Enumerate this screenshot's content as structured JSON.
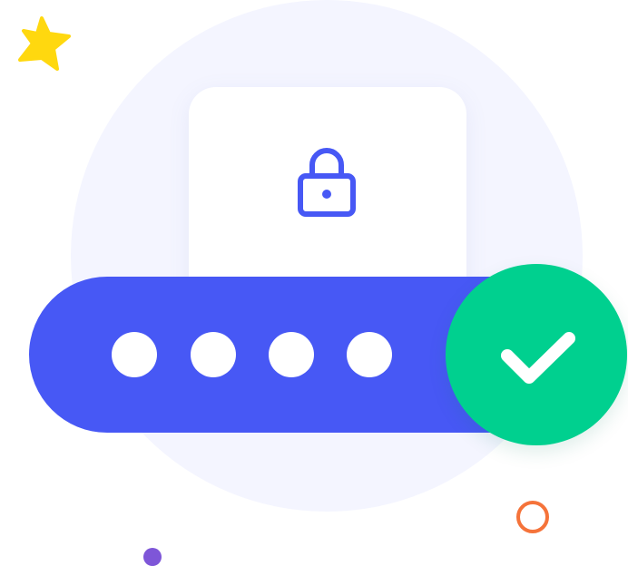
{
  "illustration": {
    "password_dots_count": 4,
    "lock_status": "locked",
    "verification_status": "success",
    "colors": {
      "background_circle": "#f4f5ff",
      "card": "#ffffff",
      "password_bar": "#4758f5",
      "lock_icon": "#4758f5",
      "success": "#00d08f",
      "star": "#ffd80f",
      "ring": "#f5733a",
      "small_dot": "#7e56d8"
    },
    "icons": [
      "lock-icon",
      "checkmark-icon",
      "star-icon",
      "ring-icon"
    ]
  }
}
